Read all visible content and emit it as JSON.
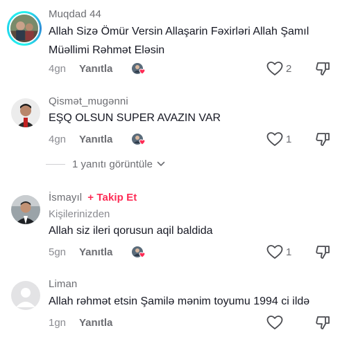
{
  "comments": [
    {
      "username": "Muqdad 44",
      "text": "Allah Sizə Ömür Versin Allaşarin Fəxirləri Allah Şamıl Müəllimi Rəhmət Eləsin",
      "time": "4gn",
      "reply_label": "Yanıtla",
      "likes": "2"
    },
    {
      "username": "Qismət_mugənni",
      "text": "EŞQ OLSUN SUPER AVAZIN VAR",
      "time": "4gn",
      "reply_label": "Yanıtla",
      "likes": "1"
    },
    {
      "username": "İsmayıl",
      "follow_label": "+ Takip Et",
      "sublabel": "Kişilerinizden",
      "text": "Allah siz ileri qorusun aqil baldida",
      "time": "5gn",
      "reply_label": "Yanıtla",
      "likes": "1"
    },
    {
      "username": "Liman",
      "text": "Allah rəhmət etsin Şamilə mənim toyumu 1994 ci ildə",
      "time": "1gn",
      "reply_label": "Yanıtla",
      "likes": ""
    }
  ],
  "view_replies_label": "1 yanıtı görüntüle",
  "icons": {
    "like": "heart-outline-icon",
    "dislike": "thumbs-down-icon",
    "creator_liked": "creator-heart-badge-icon",
    "expand": "chevron-down-icon"
  },
  "colors": {
    "accent": "#fe2c55",
    "text": "#161823",
    "muted": "#8a8b91"
  }
}
